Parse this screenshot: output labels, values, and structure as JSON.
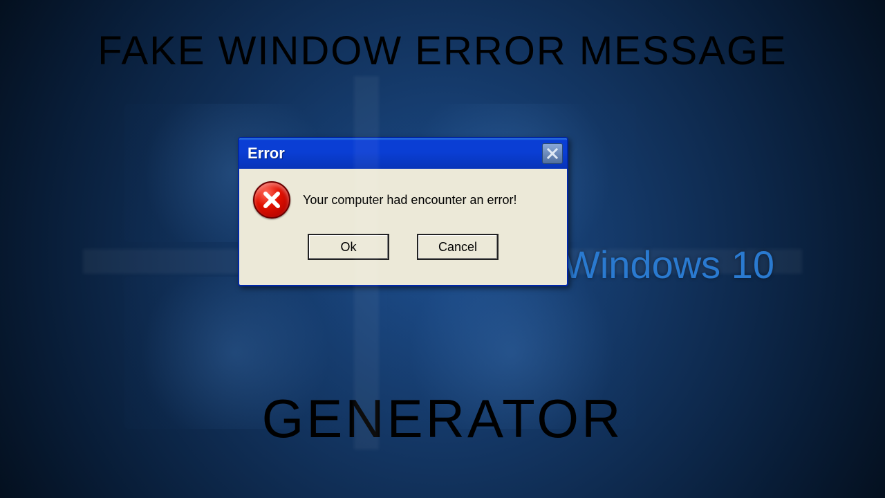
{
  "headings": {
    "top": "FAKE WINDOW ERROR MESSAGE",
    "bottom": "GENERATOR"
  },
  "brand_text": "Windows 10",
  "dialog": {
    "title": "Error",
    "message": "Your computer had encounter an error!",
    "buttons": {
      "ok": "Ok",
      "cancel": "Cancel"
    },
    "icon_name": "error-circle-x",
    "close_icon_name": "close"
  },
  "colors": {
    "brand_text": "#2a7ad0",
    "titlebar_gradient_top": "#3a8df0",
    "titlebar_gradient_bottom": "#0734b8",
    "dialog_face": "#ece9d8",
    "error_icon": "#e11000"
  }
}
